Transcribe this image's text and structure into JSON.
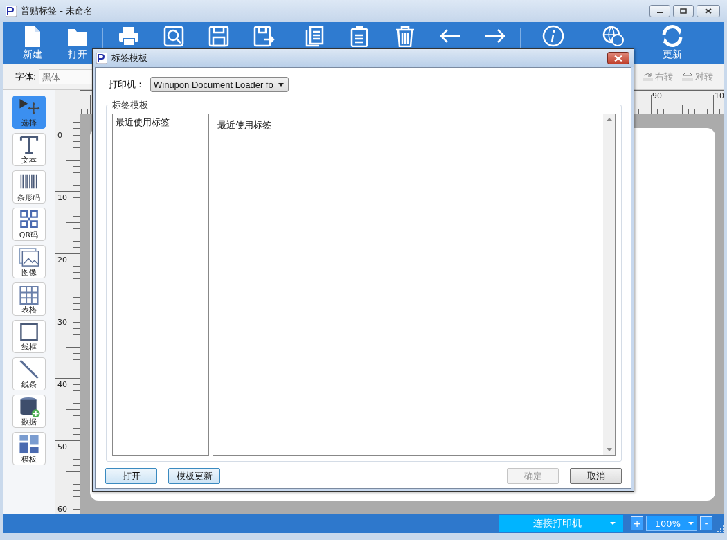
{
  "window": {
    "title": "普贴标签 - 未命名"
  },
  "toolbar": {
    "groups": [
      [
        {
          "kind": "new",
          "label": "新建"
        },
        {
          "kind": "open",
          "label": "打开"
        }
      ],
      [
        {
          "kind": "print"
        },
        {
          "kind": "preview"
        },
        {
          "kind": "save"
        },
        {
          "kind": "save_as"
        }
      ],
      [
        {
          "kind": "copy"
        },
        {
          "kind": "paste"
        },
        {
          "kind": "delete"
        },
        {
          "kind": "undo"
        },
        {
          "kind": "redo"
        }
      ],
      [
        {
          "kind": "info"
        },
        {
          "kind": "language"
        },
        {
          "kind": "update",
          "label": "更新"
        }
      ]
    ]
  },
  "format_bar": {
    "font_label": "字体:",
    "font_value": "黑体",
    "rotate_right": "右转",
    "rotate_flip": "对转"
  },
  "tools": [
    {
      "kind": "select",
      "label": "选择",
      "selected": true
    },
    {
      "kind": "text",
      "label": "文本",
      "selected": false
    },
    {
      "kind": "barcode",
      "label": "条形码",
      "selected": false
    },
    {
      "kind": "qr",
      "label": "QR码",
      "selected": false
    },
    {
      "kind": "image",
      "label": "图像",
      "selected": false
    },
    {
      "kind": "table",
      "label": "表格",
      "selected": false
    },
    {
      "kind": "frame",
      "label": "线框",
      "selected": false
    },
    {
      "kind": "line",
      "label": "线条",
      "selected": false
    },
    {
      "kind": "data",
      "label": "数据",
      "selected": false
    },
    {
      "kind": "template",
      "label": "模板",
      "selected": false
    }
  ],
  "rulers": {
    "horizontal_labels": [
      "90",
      "10"
    ],
    "vertical_labels": [
      "0",
      "10",
      "20",
      "30",
      "40",
      "50",
      "60"
    ]
  },
  "status_bar": {
    "printer": "连接打印机",
    "zoom_in": "+",
    "zoom": "100%",
    "zoom_out": "-"
  },
  "dialog": {
    "title": "标签模板",
    "printer_label": "打印机：",
    "printer_value": "Winupon Document Loader fo",
    "group_title": "标签模板",
    "categories": [
      {
        "label": "最近使用标签",
        "selected": false
      }
    ],
    "templates_header": "最近使用标签",
    "buttons": [
      {
        "kind": "open",
        "label": "打开",
        "disabled": false
      },
      {
        "kind": "update",
        "label": "模板更新",
        "disabled": false
      },
      {
        "kind": "ok",
        "label": "确定",
        "disabled": true
      },
      {
        "kind": "cancel",
        "label": "取消",
        "disabled": false
      }
    ]
  }
}
